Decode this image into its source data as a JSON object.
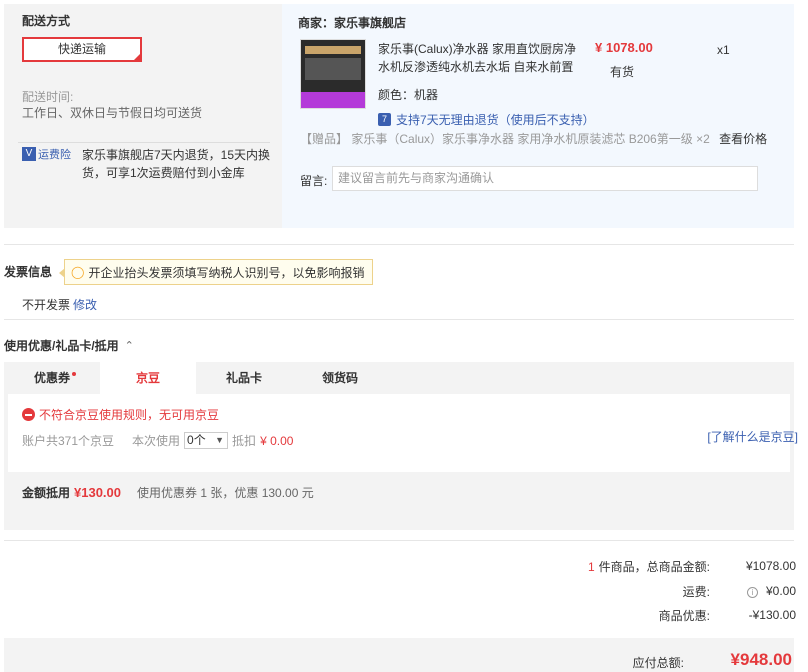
{
  "shipping": {
    "title": "配送方式",
    "method": "快递运输",
    "time_label": "配送时间:",
    "time_value": "工作日、双休日与节假日均可送货",
    "insurance_icon": "V",
    "insurance_label": "运费险",
    "insurance_text": "家乐事旗舰店7天内退货，15天内换货，可享1次运费赔付到小金库"
  },
  "merchant": {
    "label": "商家：家乐事旗舰店",
    "product_name": "家乐事(Calux)净水器 家用直饮厨房净水机反渗透纯水机去水垢 自来水前置",
    "price": "¥ 1078.00",
    "stock": "有货",
    "quantity": "x1",
    "color_label": "颜色：",
    "color_value": "机器",
    "return_icon": "7",
    "return_policy": "支持7天无理由退货（使用后不支持）",
    "gift_tag": "【赠品】",
    "gift_text": "家乐事（Calux）家乐事净水器 家用净水机原装滤芯 B206第一级 ×2",
    "gift_action": "查看价格",
    "remark_label": "留言:",
    "remark_placeholder": "建议留言前先与商家沟通确认"
  },
  "invoice": {
    "title": "发票信息",
    "tip": "开企业抬头发票须填写纳税人识别号，以免影响报销",
    "value": "不开发票",
    "edit": "修改"
  },
  "coupons": {
    "title": "使用优惠/礼品卡/抵用",
    "tabs": [
      {
        "label": "优惠券"
      },
      {
        "label": "京豆"
      },
      {
        "label": "礼品卡"
      },
      {
        "label": "领货码"
      }
    ],
    "jd_warning": "不符合京豆使用规则，无可用京豆",
    "jd_balance": "账户共371个京豆",
    "jd_use_label": "本次使用",
    "jd_select": "0个",
    "jd_deduct_label": "抵扣",
    "jd_deduct_value": "¥ 0.00",
    "jd_help": "[了解什么是京豆]",
    "summary_label": "金额抵用",
    "summary_amount": "¥130.00",
    "summary_desc": "使用优惠券 1 张，优惠 130.00 元"
  },
  "totals": {
    "count": "1",
    "items_label": "件商品，总商品金额:",
    "items_value": "¥1078.00",
    "freight_label": "运费:",
    "freight_value": "¥0.00",
    "discount_label": "商品优惠:",
    "discount_value": "-¥130.00",
    "pay_label": "应付总额:",
    "pay_value": "¥948.00"
  },
  "colors": {
    "accent": "#e4393c",
    "link": "#3a5fb0",
    "panel": "#f3f3f3",
    "merchant_bg": "#f3f8fe"
  }
}
